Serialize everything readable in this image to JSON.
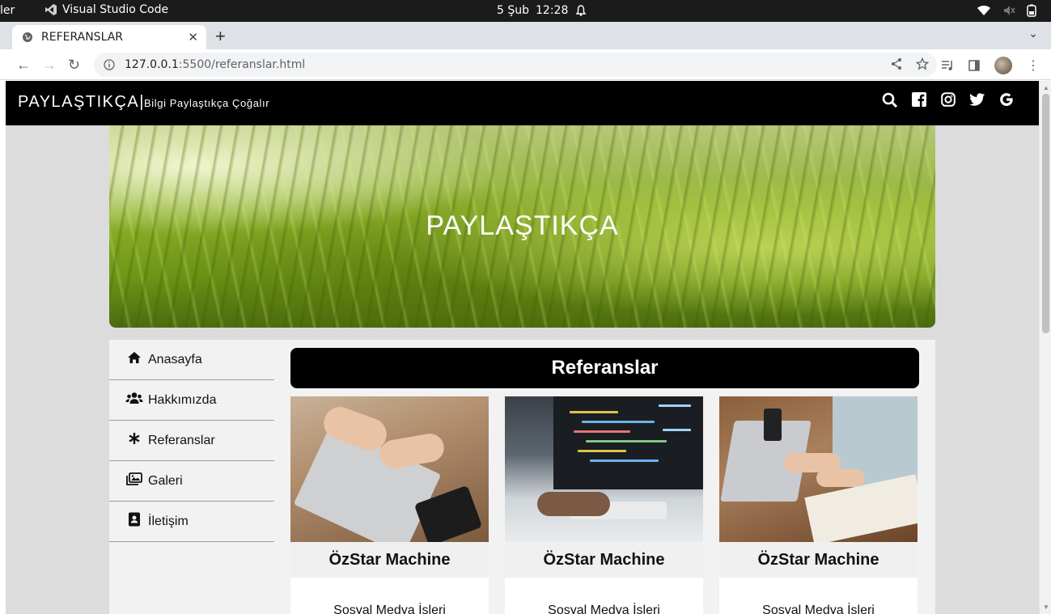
{
  "os": {
    "left_app": "ler",
    "active_app": "Visual Studio Code",
    "date": "5 Şub",
    "time": "12:28"
  },
  "browser": {
    "tab_title": "REFERANSLAR",
    "url_host": "127.0.0.1",
    "url_path": ":5500/referanslar.html"
  },
  "header": {
    "brand": "PAYLAŞTIKÇA|",
    "slogan": "Bilgi Paylaştıkça Çoğalır",
    "icons": [
      "search-icon",
      "facebook-icon",
      "instagram-icon",
      "twitter-icon",
      "google-icon"
    ]
  },
  "hero": {
    "title": "PAYLAŞTIKÇA"
  },
  "menu": {
    "items": [
      {
        "label": "Anasayfa",
        "icon": "home-icon"
      },
      {
        "label": "Hakkımızda",
        "icon": "users-icon"
      },
      {
        "label": "Referanslar",
        "icon": "asterisk-icon"
      },
      {
        "label": "Galeri",
        "icon": "images-icon"
      },
      {
        "label": "İletişim",
        "icon": "contact-book-icon"
      }
    ]
  },
  "main": {
    "title": "Referanslar",
    "cards": [
      {
        "name": "ÖzStar Machine",
        "desc": "Sosyal Medya İşleri"
      },
      {
        "name": "ÖzStar Machine",
        "desc": "Sosyal Medya İşleri"
      },
      {
        "name": "ÖzStar Machine",
        "desc": "Sosyal Medya İşleri"
      }
    ]
  },
  "colors": {
    "header_bg": "#000000",
    "content_bg": "#f2f2f2",
    "page_bg": "#dcdcdc"
  }
}
